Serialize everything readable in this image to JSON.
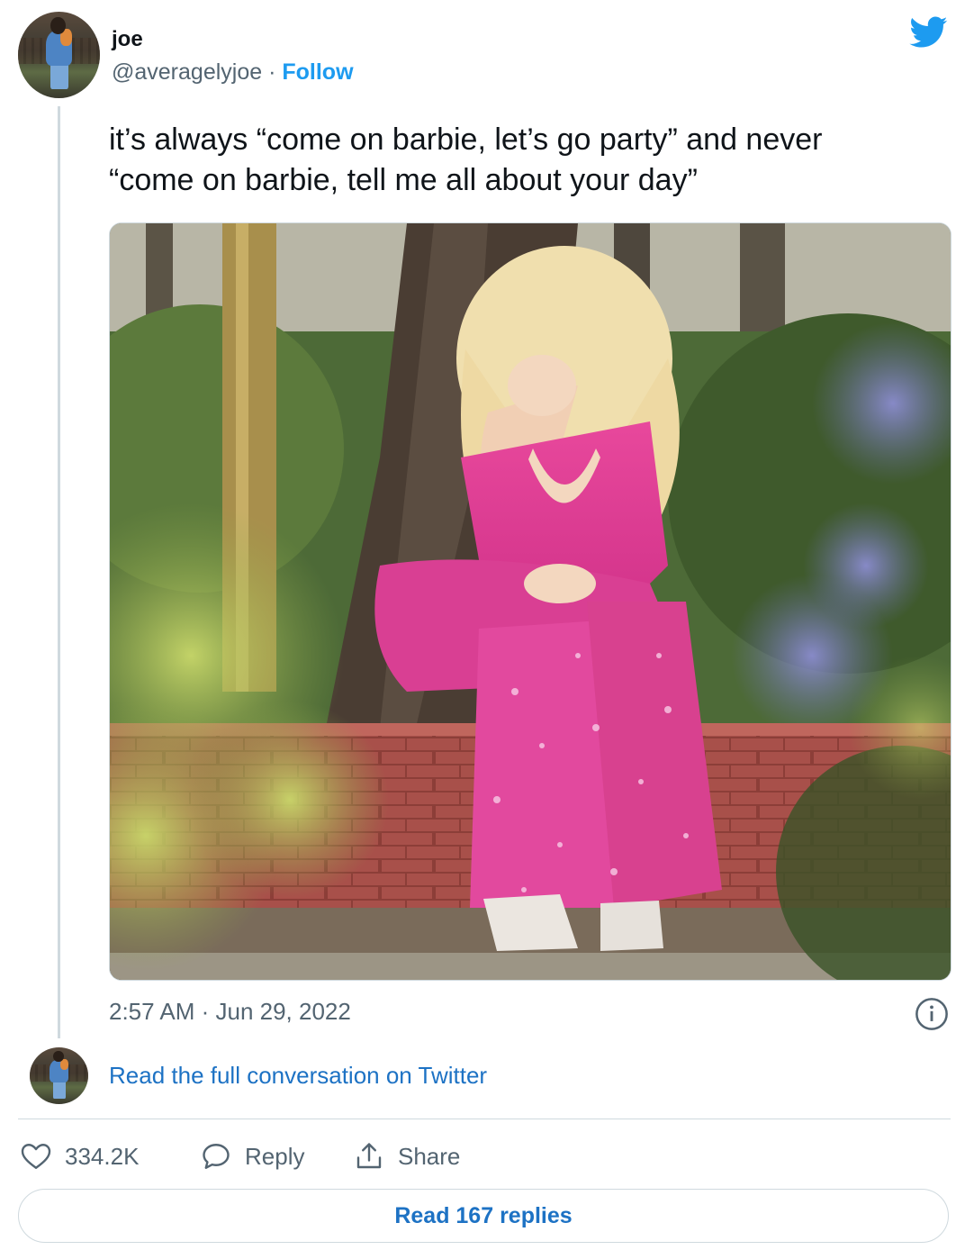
{
  "author": {
    "display_name": "joe",
    "handle": "@averagelyjoe",
    "separator": "·",
    "follow_label": "Follow"
  },
  "tweet": {
    "text_line1": "it’s always “come on barbie, let’s go party” and never",
    "text_line2": "“come on barbie, tell me all about your day”",
    "timestamp": "2:57 AM · Jun 29, 2022"
  },
  "conversation_link": "Read the full conversation on Twitter",
  "actions": {
    "like_count": "334.2K",
    "reply_label": "Reply",
    "share_label": "Share"
  },
  "read_replies_label": "Read 167 replies",
  "icons": {
    "brand": "twitter-bird-icon",
    "info": "info-icon",
    "like": "heart-icon",
    "reply": "speech-bubble-icon",
    "share": "share-upload-icon"
  },
  "colors": {
    "accent": "#1d9bf0",
    "link": "#1d72c4",
    "muted": "#536471",
    "border": "#cfd9de",
    "text": "#0f1419"
  }
}
